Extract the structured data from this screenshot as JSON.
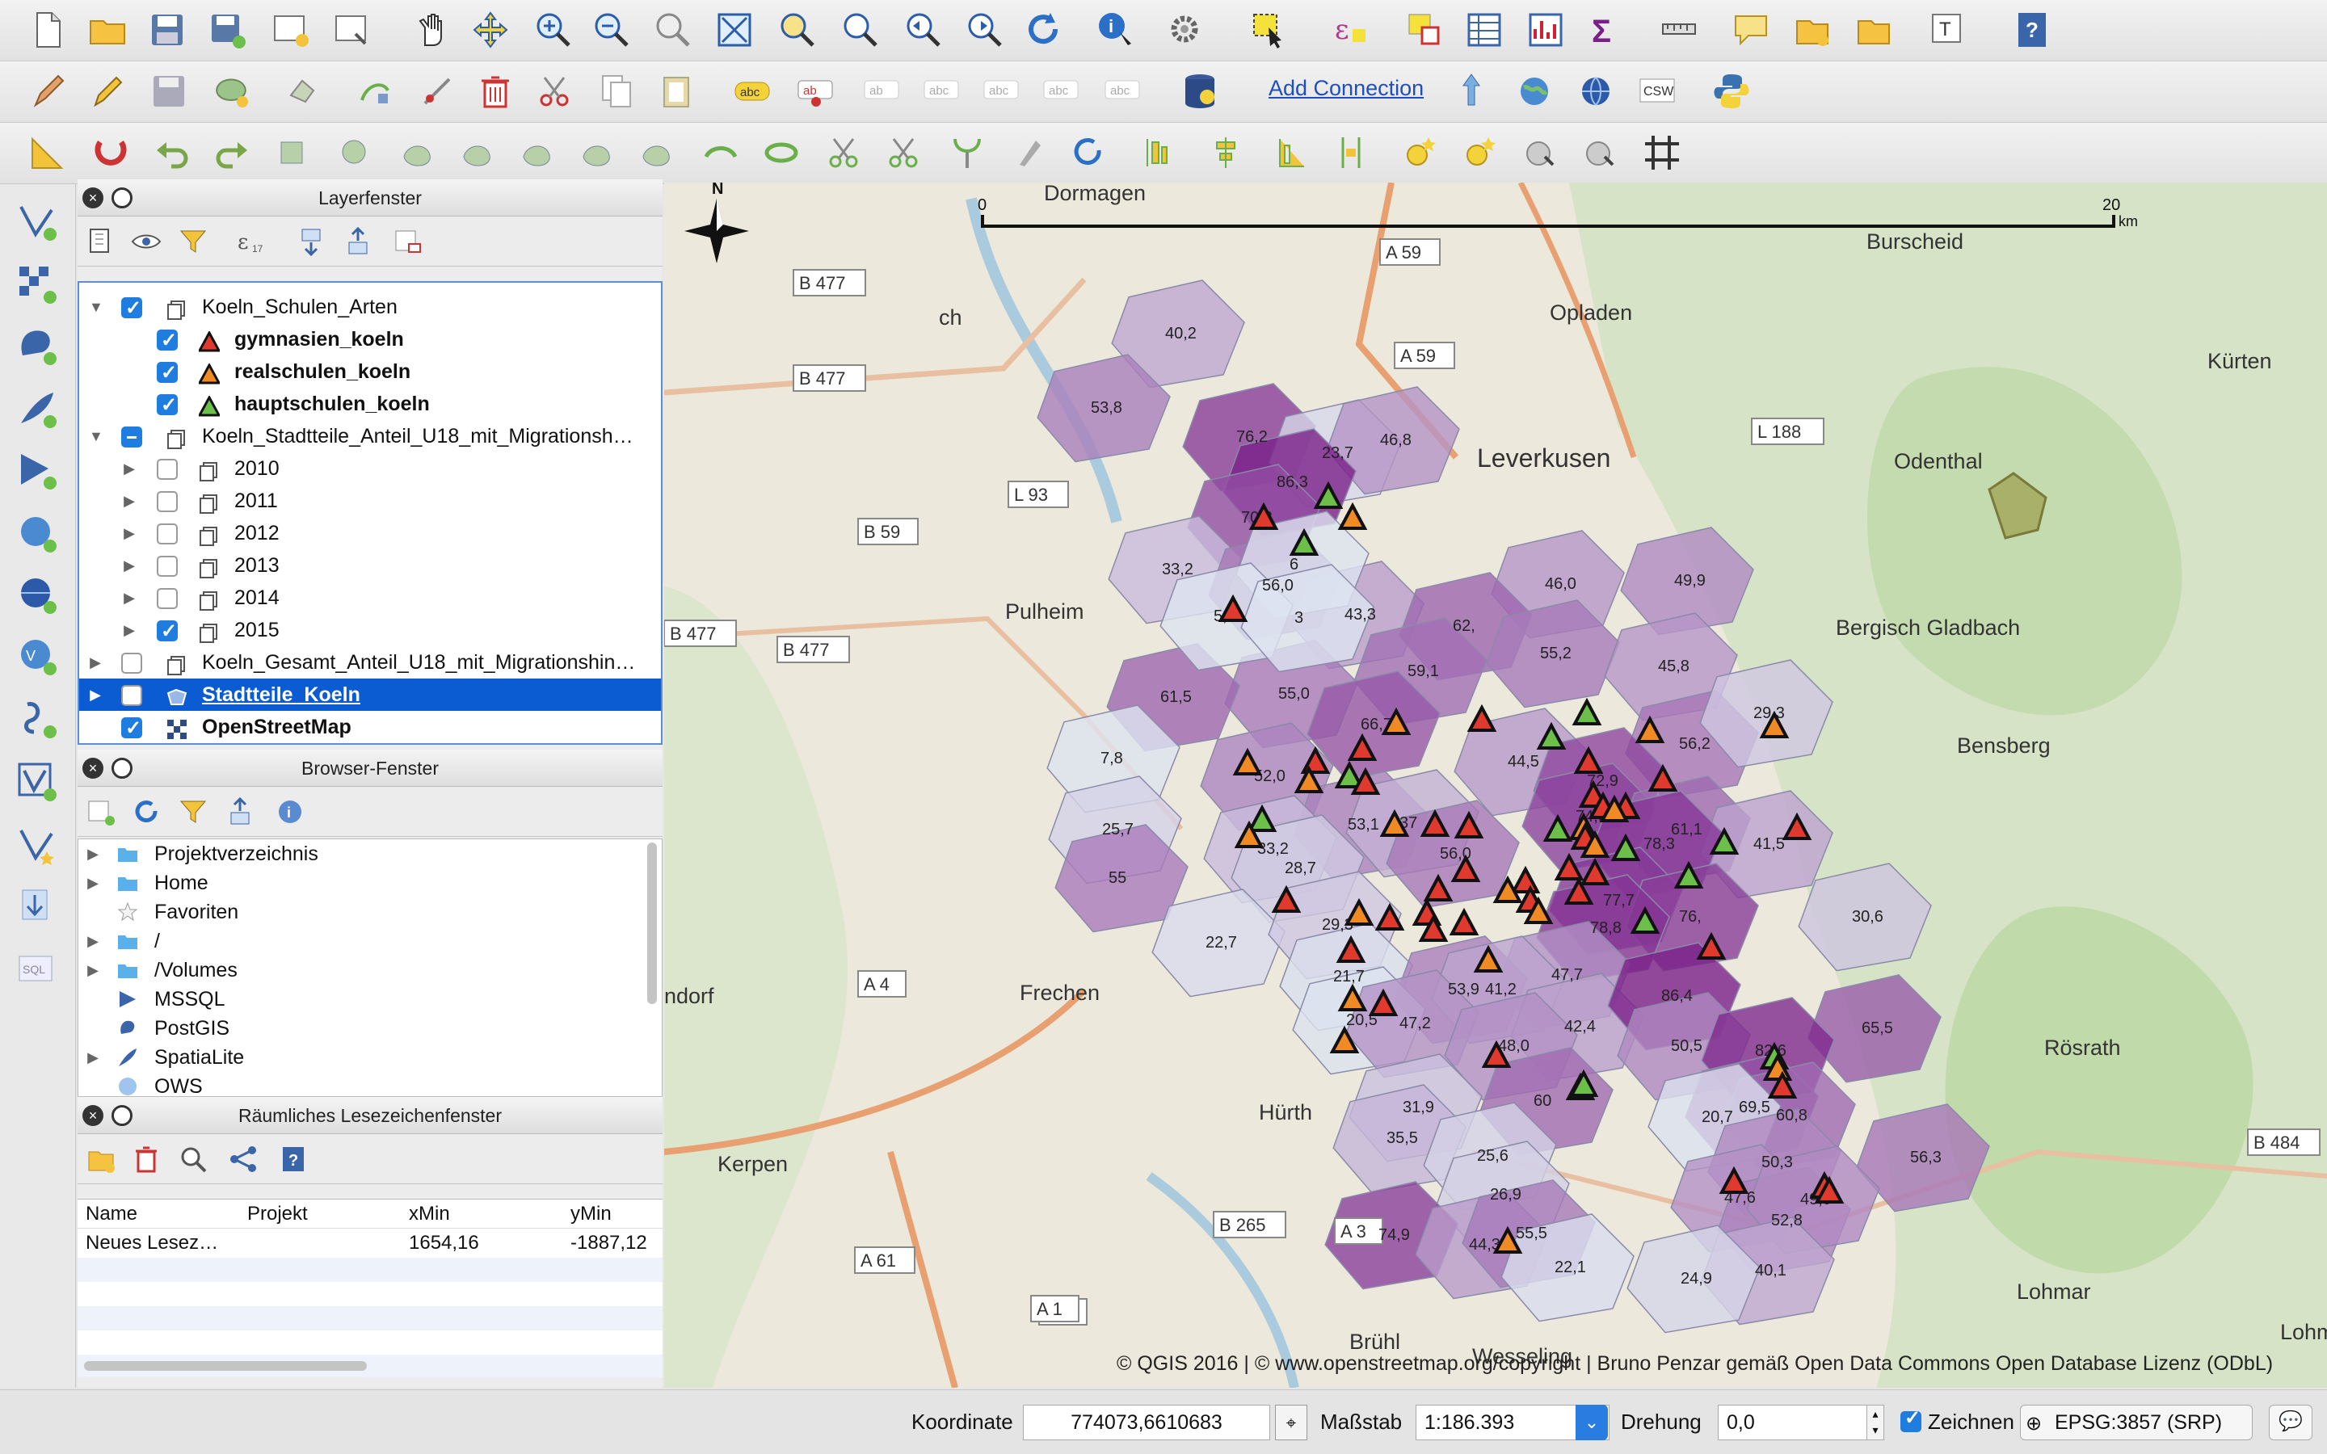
{
  "toolbar": {
    "add_connection": "Add Connection"
  },
  "layers_panel": {
    "title": "Layerfenster",
    "items": [
      {
        "name": "Koeln_Schulen_Arten",
        "checked": "on",
        "expanded": true,
        "indent": 0
      },
      {
        "name": "gymnasien_koeln",
        "checked": "on",
        "indent": 1,
        "symbol": "triangle-red"
      },
      {
        "name": "realschulen_koeln",
        "checked": "on",
        "indent": 1,
        "symbol": "triangle-orange"
      },
      {
        "name": "hauptschulen_koeln",
        "checked": "on",
        "indent": 1,
        "symbol": "triangle-green"
      },
      {
        "name": "Koeln_Stadtteile_Anteil_U18_mit_Migrationsh…",
        "checked": "partial",
        "expanded": true,
        "indent": 0
      },
      {
        "name": "2010",
        "checked": "off",
        "indent": 1
      },
      {
        "name": "2011",
        "checked": "off",
        "indent": 1
      },
      {
        "name": "2012",
        "checked": "off",
        "indent": 1
      },
      {
        "name": "2013",
        "checked": "off",
        "indent": 1
      },
      {
        "name": "2014",
        "checked": "off",
        "indent": 1
      },
      {
        "name": "2015",
        "checked": "on",
        "indent": 1
      },
      {
        "name": "Koeln_Gesamt_Anteil_U18_mit_Migrationshin…",
        "checked": "off",
        "indent": 0
      },
      {
        "name": "Stadtteile_Koeln",
        "checked": "off",
        "indent": 0,
        "selected": true
      },
      {
        "name": "OpenStreetMap",
        "checked": "on",
        "indent": 0
      }
    ]
  },
  "browser_panel": {
    "title": "Browser-Fenster",
    "items": [
      "Projektverzeichnis",
      "Home",
      "Favoriten",
      "/",
      "/Volumes",
      "MSSQL",
      "PostGIS",
      "SpatiaLite",
      "OWS"
    ]
  },
  "bookmarks_panel": {
    "title": "Räumliches Lesezeichenfenster",
    "columns": [
      "Name",
      "Projekt",
      "xMin",
      "yMin"
    ],
    "rows": [
      [
        "Neues Lesez…",
        "",
        "1654,16",
        "-1887,12"
      ]
    ]
  },
  "map": {
    "places": [
      "Dormagen",
      "Opladen",
      "Leverkusen",
      "Odenthal",
      "Burscheid",
      "Kürten",
      "Pulheim",
      "Bergisch Gladbach",
      "Bensberg",
      "Frechen",
      "Hürth",
      "Kerpen",
      "Brühl",
      "Rösrath",
      "Lohmar",
      "Wesseling",
      "Lohmarer",
      "ndorf",
      "ch"
    ],
    "roads": [
      "B 477",
      "B 477",
      "B 477",
      "B 477",
      "B 59",
      "L 93",
      "A 59",
      "A 59",
      "L 188",
      "A 4",
      "A 1",
      "A 1",
      "A 61",
      "B 265",
      "B 484",
      "A 3"
    ],
    "district_values": [
      "40,2",
      "53,8",
      "76,2",
      "23,7",
      "46,8",
      "86,3",
      "70,3",
      "33,2",
      "56,0",
      "43,3",
      "46,0",
      "49,9",
      "62,",
      "55,2",
      "45,8",
      "59,1",
      "55,0",
      "61,5",
      "66,7",
      "56,2",
      "29,3",
      "44,5",
      "72,9",
      "7,8",
      "52,0",
      "53,1",
      "74,0",
      "61,1",
      "41,5",
      "25,7",
      "33,2",
      "28,7",
      "37",
      "56,0",
      "78,3",
      "30,6",
      "55",
      "22,7",
      "29,3",
      "77,7",
      "76,",
      "78,8",
      "47,7",
      "21,7",
      "53,9",
      "41,2",
      "42,4",
      "86,4",
      "65,5",
      "20,5",
      "47,2",
      "48,0",
      "50,5",
      "82,6",
      "31,9",
      "60",
      "69,5",
      "60,8",
      "35,5",
      "25,6",
      "20,7",
      "56,3",
      "26,9",
      "50,3",
      "47,6",
      "52,8",
      "49,9",
      "74,9",
      "44,3",
      "55,5",
      "22,1",
      "40,1",
      "24,9",
      "6",
      "5,5",
      "3"
    ],
    "scale": {
      "zero": "0",
      "max": "20",
      "unit": "km"
    },
    "north": "N",
    "attribution": "© QGIS 2016 | © www.openstreetmap.org/copyright | Bruno Penzar gemäß Open Data Commons Open Database Lizenz (ODbL)"
  },
  "statusbar": {
    "coordinate_label": "Koordinate",
    "coordinate_value": "774073,6610683",
    "scale_label": "Maßstab",
    "scale_value": "1:186.393",
    "rotation_label": "Drehung",
    "rotation_value": "0,0",
    "render_label": "Zeichnen",
    "crs": "EPSG:3857 (SRP)"
  },
  "colors": {
    "accent": "#0b5bd3",
    "gymnasien": "#e03a2f",
    "realschulen": "#f08a24",
    "hauptschulen": "#6cc04a",
    "choropleth_dark": "#7a1f8a",
    "choropleth_light": "#dde3f0"
  }
}
